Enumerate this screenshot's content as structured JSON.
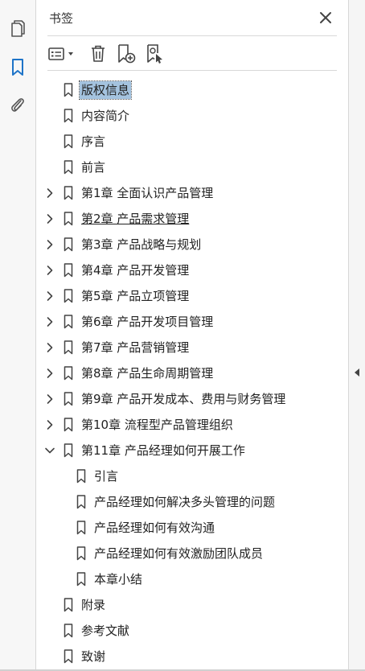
{
  "panel": {
    "title": "书签"
  },
  "icons": {
    "pages": "pages-icon",
    "bookmarks": "bookmark-icon",
    "attachments": "paperclip-icon",
    "close": "close-icon",
    "options": "options-list-icon",
    "delete": "trash-icon",
    "new_bookmark": "new-bookmark-icon",
    "new_from_structure": "bookmark-from-structure-icon",
    "collapse_panel": "triangle-left-icon"
  },
  "colors": {
    "selection_bg": "#a4c3df",
    "active_rail_icon": "#1e74c8"
  },
  "bookmarks": [
    {
      "label": "版权信息",
      "level": 0,
      "expandable": false,
      "expanded": false,
      "selected": true,
      "underlined": false
    },
    {
      "label": "内容简介",
      "level": 0,
      "expandable": false,
      "expanded": false,
      "selected": false,
      "underlined": false
    },
    {
      "label": "序言",
      "level": 0,
      "expandable": false,
      "expanded": false,
      "selected": false,
      "underlined": false
    },
    {
      "label": "前言",
      "level": 0,
      "expandable": false,
      "expanded": false,
      "selected": false,
      "underlined": false
    },
    {
      "label": "第1章 全面认识产品管理",
      "level": 0,
      "expandable": true,
      "expanded": false,
      "selected": false,
      "underlined": false
    },
    {
      "label": "第2章 产品需求管理",
      "level": 0,
      "expandable": true,
      "expanded": false,
      "selected": false,
      "underlined": true
    },
    {
      "label": "第3章 产品战略与规划",
      "level": 0,
      "expandable": true,
      "expanded": false,
      "selected": false,
      "underlined": false
    },
    {
      "label": "第4章 产品开发管理",
      "level": 0,
      "expandable": true,
      "expanded": false,
      "selected": false,
      "underlined": false
    },
    {
      "label": "第5章 产品立项管理",
      "level": 0,
      "expandable": true,
      "expanded": false,
      "selected": false,
      "underlined": false
    },
    {
      "label": "第6章 产品开发项目管理",
      "level": 0,
      "expandable": true,
      "expanded": false,
      "selected": false,
      "underlined": false
    },
    {
      "label": "第7章 产品营销管理",
      "level": 0,
      "expandable": true,
      "expanded": false,
      "selected": false,
      "underlined": false
    },
    {
      "label": "第8章 产品生命周期管理",
      "level": 0,
      "expandable": true,
      "expanded": false,
      "selected": false,
      "underlined": false
    },
    {
      "label": "第9章 产品开发成本、费用与财务管理",
      "level": 0,
      "expandable": true,
      "expanded": false,
      "selected": false,
      "underlined": false
    },
    {
      "label": "第10章 流程型产品管理组织",
      "level": 0,
      "expandable": true,
      "expanded": false,
      "selected": false,
      "underlined": false
    },
    {
      "label": "第11章 产品经理如何开展工作",
      "level": 0,
      "expandable": true,
      "expanded": true,
      "selected": false,
      "underlined": false
    },
    {
      "label": "引言",
      "level": 1,
      "expandable": false,
      "expanded": false,
      "selected": false,
      "underlined": false
    },
    {
      "label": "产品经理如何解决多头管理的问题",
      "level": 1,
      "expandable": false,
      "expanded": false,
      "selected": false,
      "underlined": false
    },
    {
      "label": "产品经理如何有效沟通",
      "level": 1,
      "expandable": false,
      "expanded": false,
      "selected": false,
      "underlined": false
    },
    {
      "label": "产品经理如何有效激励团队成员",
      "level": 1,
      "expandable": false,
      "expanded": false,
      "selected": false,
      "underlined": false
    },
    {
      "label": "本章小结",
      "level": 1,
      "expandable": false,
      "expanded": false,
      "selected": false,
      "underlined": false
    },
    {
      "label": "附录",
      "level": 0,
      "expandable": false,
      "expanded": false,
      "selected": false,
      "underlined": false
    },
    {
      "label": "参考文献",
      "level": 0,
      "expandable": false,
      "expanded": false,
      "selected": false,
      "underlined": false
    },
    {
      "label": "致谢",
      "level": 0,
      "expandable": false,
      "expanded": false,
      "selected": false,
      "underlined": false
    }
  ]
}
